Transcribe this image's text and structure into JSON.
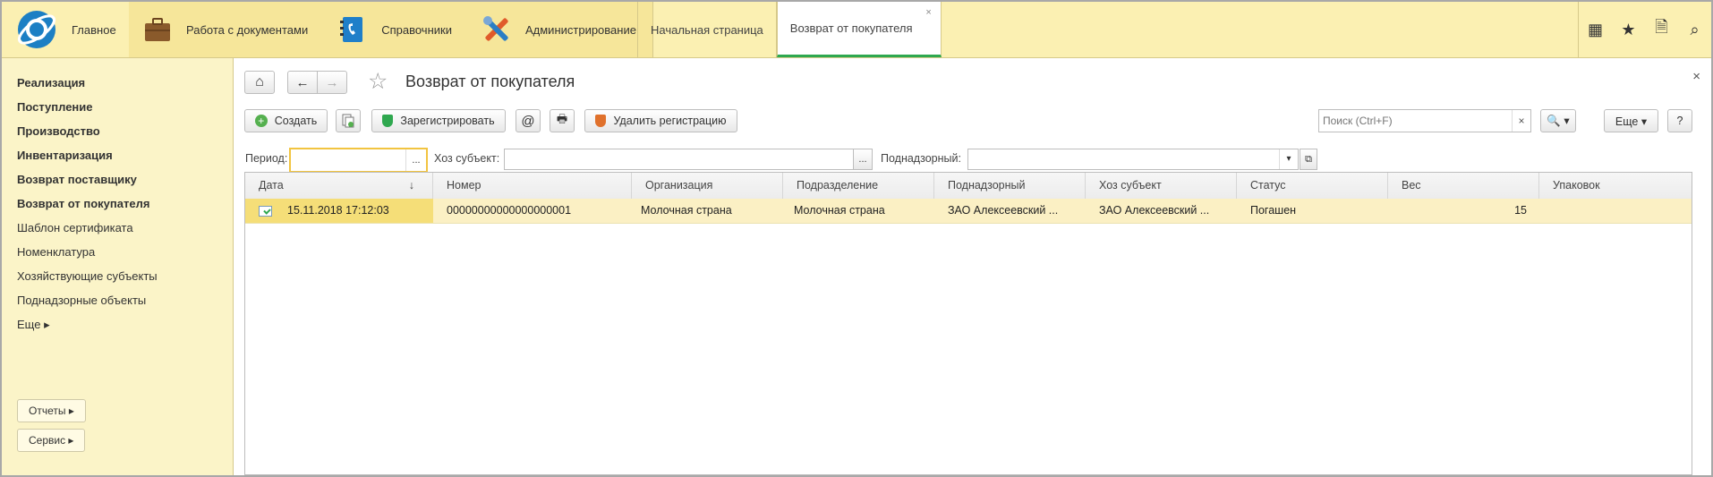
{
  "header": {
    "logo_label": "Главное",
    "sections": [
      {
        "label": "Работа с документами",
        "icon": "briefcase-icon"
      },
      {
        "label": "Справочники",
        "icon": "phonebook-icon"
      },
      {
        "label": "Администрирование",
        "icon": "tools-icon"
      }
    ],
    "tabs": [
      {
        "label": "Начальная страница"
      },
      {
        "label": "Возврат от покупателя",
        "close": "×"
      }
    ],
    "tools": [
      "▦",
      "★",
      "🗎",
      "⌕"
    ]
  },
  "sidebar": {
    "items": [
      {
        "label": "Реализация",
        "bold": true
      },
      {
        "label": "Поступление",
        "bold": true
      },
      {
        "label": "Производство",
        "bold": true
      },
      {
        "label": "Инвентаризация",
        "bold": true
      },
      {
        "label": "Возврат поставщику",
        "bold": true
      },
      {
        "label": "Возврат от покупателя",
        "bold": true
      },
      {
        "label": "Шаблон сертификата",
        "bold": false
      },
      {
        "label": "Номенклатура",
        "bold": false
      },
      {
        "label": "Хозяйствующие субъекты",
        "bold": false
      },
      {
        "label": "Поднадзорные объекты",
        "bold": false
      },
      {
        "label": "Еще ▸",
        "bold": false
      }
    ],
    "buttons": [
      {
        "label": "Отчеты ▸"
      },
      {
        "label": "Сервис ▸"
      }
    ]
  },
  "form": {
    "title": "Возврат от покупателя",
    "close": "×",
    "toolbar": {
      "home": "⌂",
      "back": "←",
      "forward": "→",
      "star": "☆",
      "create": "Создать",
      "register": "Зарегистрировать",
      "email": "@",
      "print": "🖶",
      "unregister": "Удалить регистрацию",
      "search_placeholder": "Поиск (Ctrl+F)",
      "search_clear": "×",
      "search_btn": "🔍 ▾",
      "more": "Еще ▾",
      "help": "?"
    },
    "filters": {
      "period_label": "Период:",
      "period_value": "",
      "period_btn": "...",
      "entity_label": "Хоз субъект:",
      "entity_value": "",
      "entity_btn": "...",
      "supervised_label": "Поднадзорный:",
      "supervised_value": "",
      "supervised_drop": "▾",
      "supervised_open": "⧉"
    },
    "table": {
      "columns": [
        "Дата",
        "Номер",
        "Организация",
        "Подразделение",
        "Поднадзорный",
        "Хоз субъект",
        "Статус",
        "Вес",
        "Упаковок"
      ],
      "sort_indicator": "↓",
      "rows": [
        {
          "date": "15.11.2018 17:12:03",
          "number": "00000000000000000001",
          "org": "Молочная страна",
          "division": "Молочная страна",
          "supervised": "ЗАО Алексеевский ...",
          "entity": "ЗАО  Алексеевский ...",
          "status": "Погашен",
          "weight": "15",
          "packs": ""
        }
      ]
    }
  }
}
